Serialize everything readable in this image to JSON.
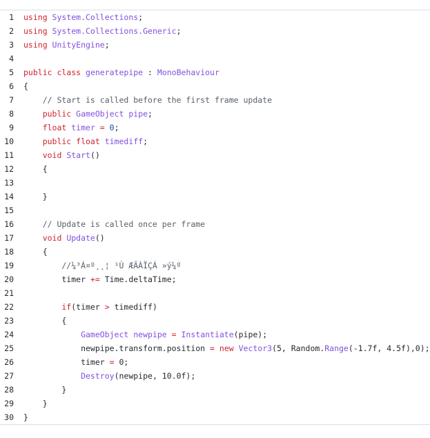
{
  "code_lines": [
    {
      "num": "1",
      "tokens": [
        {
          "t": "using ",
          "c": "k"
        },
        {
          "t": "System.Collections",
          "c": "t"
        },
        {
          "t": ";",
          "c": "n"
        }
      ]
    },
    {
      "num": "2",
      "tokens": [
        {
          "t": "using ",
          "c": "k"
        },
        {
          "t": "System.Collections.Generic",
          "c": "t"
        },
        {
          "t": ";",
          "c": "n"
        }
      ]
    },
    {
      "num": "3",
      "tokens": [
        {
          "t": "using ",
          "c": "k"
        },
        {
          "t": "UnityEngine",
          "c": "t"
        },
        {
          "t": ";",
          "c": "n"
        }
      ]
    },
    {
      "num": "4",
      "tokens": []
    },
    {
      "num": "5",
      "tokens": [
        {
          "t": "public class ",
          "c": "k"
        },
        {
          "t": "generatepipe",
          "c": "t"
        },
        {
          "t": " : ",
          "c": "n"
        },
        {
          "t": "MonoBehaviour",
          "c": "t"
        }
      ]
    },
    {
      "num": "6",
      "tokens": [
        {
          "t": "{",
          "c": "n"
        }
      ]
    },
    {
      "num": "7",
      "tokens": [
        {
          "t": "    // Start is called before the first frame update",
          "c": "c"
        }
      ]
    },
    {
      "num": "8",
      "tokens": [
        {
          "t": "    public ",
          "c": "k"
        },
        {
          "t": "GameObject ",
          "c": "t"
        },
        {
          "t": "pipe",
          "c": "t"
        },
        {
          "t": ";",
          "c": "n"
        }
      ]
    },
    {
      "num": "9",
      "tokens": [
        {
          "t": "    float ",
          "c": "k"
        },
        {
          "t": "timer",
          "c": "t"
        },
        {
          "t": " = ",
          "c": "k"
        },
        {
          "t": "0",
          "c": "o"
        },
        {
          "t": ";",
          "c": "n"
        }
      ]
    },
    {
      "num": "10",
      "tokens": [
        {
          "t": "    public float ",
          "c": "k"
        },
        {
          "t": "timediff",
          "c": "t"
        },
        {
          "t": ";",
          "c": "n"
        }
      ]
    },
    {
      "num": "11",
      "tokens": [
        {
          "t": "    void ",
          "c": "k"
        },
        {
          "t": "Start",
          "c": "t"
        },
        {
          "t": "()",
          "c": "n"
        }
      ]
    },
    {
      "num": "12",
      "tokens": [
        {
          "t": "    {",
          "c": "n"
        }
      ]
    },
    {
      "num": "13",
      "tokens": []
    },
    {
      "num": "14",
      "tokens": [
        {
          "t": "    }",
          "c": "n"
        }
      ]
    },
    {
      "num": "15",
      "tokens": []
    },
    {
      "num": "16",
      "tokens": [
        {
          "t": "    // Update is called once per frame",
          "c": "c"
        }
      ]
    },
    {
      "num": "17",
      "tokens": [
        {
          "t": "    void ",
          "c": "k"
        },
        {
          "t": "Update",
          "c": "t"
        },
        {
          "t": "()",
          "c": "n"
        }
      ]
    },
    {
      "num": "18",
      "tokens": [
        {
          "t": "    {",
          "c": "n"
        }
      ]
    },
    {
      "num": "19",
      "tokens": [
        {
          "t": "        //¼³Á¤º¸¸¦ ¹Ù ÆÄÀÏÇÁ »ý¼º",
          "c": "c"
        }
      ]
    },
    {
      "num": "20",
      "tokens": [
        {
          "t": "        timer ",
          "c": "n"
        },
        {
          "t": "+=",
          "c": "k"
        },
        {
          "t": " Time.deltaTime;",
          "c": "n"
        }
      ]
    },
    {
      "num": "21",
      "tokens": []
    },
    {
      "num": "22",
      "tokens": [
        {
          "t": "        if",
          "c": "k"
        },
        {
          "t": "(timer ",
          "c": "n"
        },
        {
          "t": ">",
          "c": "k"
        },
        {
          "t": " timediff)",
          "c": "n"
        }
      ]
    },
    {
      "num": "23",
      "tokens": [
        {
          "t": "        {",
          "c": "n"
        }
      ]
    },
    {
      "num": "24",
      "tokens": [
        {
          "t": "            GameObject ",
          "c": "t"
        },
        {
          "t": "newpipe",
          "c": "t"
        },
        {
          "t": " = ",
          "c": "k"
        },
        {
          "t": "Instantiate",
          "c": "t"
        },
        {
          "t": "(pipe);",
          "c": "n"
        }
      ]
    },
    {
      "num": "25",
      "tokens": [
        {
          "t": "            newpipe.transform.position ",
          "c": "n"
        },
        {
          "t": "= ",
          "c": "k"
        },
        {
          "t": "new ",
          "c": "k"
        },
        {
          "t": "Vector3",
          "c": "t"
        },
        {
          "t": "(5, Random.",
          "c": "n"
        },
        {
          "t": "Range",
          "c": "t"
        },
        {
          "t": "(-1.7f, 4.5f),0);",
          "c": "n"
        }
      ]
    },
    {
      "num": "26",
      "tokens": [
        {
          "t": "            timer ",
          "c": "n"
        },
        {
          "t": "=",
          "c": "k"
        },
        {
          "t": " 0;",
          "c": "n"
        }
      ]
    },
    {
      "num": "27",
      "tokens": [
        {
          "t": "            Destroy",
          "c": "t"
        },
        {
          "t": "(newpipe, 10.0f);",
          "c": "n"
        }
      ]
    },
    {
      "num": "28",
      "tokens": [
        {
          "t": "        }",
          "c": "n"
        }
      ]
    },
    {
      "num": "29",
      "tokens": [
        {
          "t": "    }",
          "c": "n"
        }
      ]
    },
    {
      "num": "30",
      "tokens": [
        {
          "t": "}",
          "c": "n"
        }
      ]
    }
  ]
}
